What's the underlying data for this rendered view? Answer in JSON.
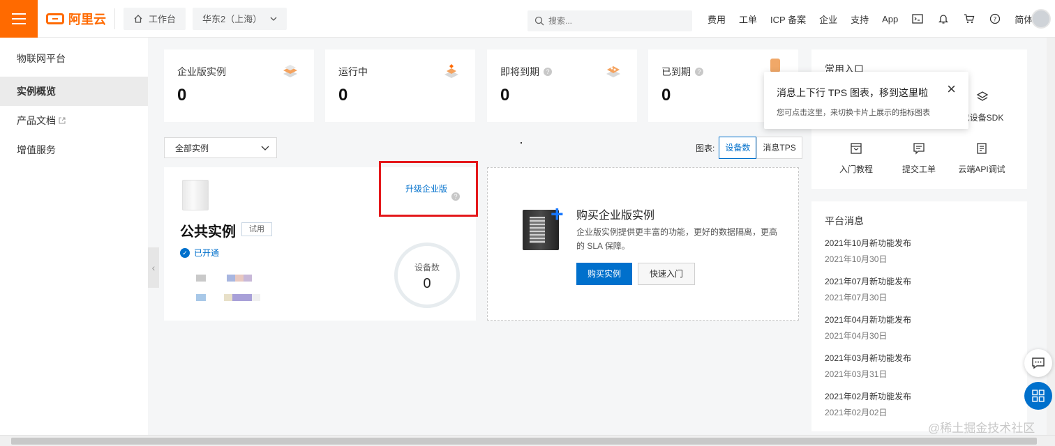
{
  "header": {
    "logo_text": "阿里云",
    "workbench_label": "工作台",
    "region_label": "华东2（上海）",
    "search_placeholder": "搜索...",
    "nav": [
      "费用",
      "工单",
      "ICP 备案",
      "企业",
      "支持",
      "App"
    ],
    "lang_label": "简体",
    "accent_color": "#ff6a00"
  },
  "sidebar": {
    "title": "物联网平台",
    "items": [
      {
        "label": "实例概览",
        "active": true
      },
      {
        "label": "产品文档",
        "external": true
      },
      {
        "label": "增值服务"
      }
    ]
  },
  "stats": [
    {
      "label": "企业版实例",
      "value": "0",
      "icon": "cube-stack-icon"
    },
    {
      "label": "运行中",
      "value": "0",
      "icon": "cube-running-icon",
      "help": true
    },
    {
      "label": "即将到期",
      "value": "0",
      "icon": "cube-expiring-icon",
      "help": true
    },
    {
      "label": "已到期",
      "value": "0",
      "icon": "cube-expired-icon",
      "help": true
    }
  ],
  "filter": {
    "instance_select": "全部实例",
    "chart_label": "图表:",
    "chart_options": [
      "设备数",
      "消息TPS"
    ],
    "chart_selected": "设备数"
  },
  "public_instance": {
    "title": "公共实例",
    "tag": "试用",
    "status": "已开通",
    "upgrade_link": "升级企业版",
    "device_count_label": "设备数",
    "device_count": "0"
  },
  "buy_card": {
    "title": "购买企业版实例",
    "description": "企业版实例提供更丰富的功能，更好的数据隔离，更高的 SLA 保障。",
    "primary_button": "购买实例",
    "secondary_button": "快速入门"
  },
  "quick_entry": {
    "title": "常用入口",
    "items": [
      {
        "label": "载设备SDK",
        "icon": "layers-icon"
      },
      {
        "label": "入门教程",
        "icon": "book-icon"
      },
      {
        "label": "提交工单",
        "icon": "ticket-icon"
      },
      {
        "label": "云端API调试",
        "icon": "api-debug-icon"
      }
    ]
  },
  "news": {
    "title": "平台消息",
    "items": [
      {
        "title": "2021年10月新功能发布",
        "date": "2021年10月30日"
      },
      {
        "title": "2021年07月新功能发布",
        "date": "2021年07月30日"
      },
      {
        "title": "2021年04月新功能发布",
        "date": "2021年04月30日"
      },
      {
        "title": "2021年03月新功能发布",
        "date": "2021年03月31日"
      },
      {
        "title": "2021年02月新功能发布",
        "date": "2021年02月02日"
      }
    ]
  },
  "tooltip": {
    "title": "消息上下行 TPS 图表，移到这里啦",
    "body": "您可点击这里，来切换卡片上展示的指标图表"
  },
  "watermark": "@稀土掘金技术社区"
}
